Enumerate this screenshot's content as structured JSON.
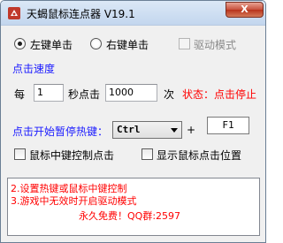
{
  "window": {
    "title": "天蝎鼠标连点器 V19.1",
    "close_glyph": "X"
  },
  "mouse_button": {
    "left_label": "左键单击",
    "right_label": "右键单击",
    "selected": "left"
  },
  "driver_mode": {
    "label": "驱动模式",
    "checked": false,
    "enabled": false
  },
  "speed": {
    "section_label": "点击速度",
    "prefix": "每",
    "seconds_value": "1",
    "middle": "秒点击",
    "clicks_value": "1000",
    "suffix": "次"
  },
  "status": {
    "text": "状态：点击停止",
    "color": "#ff0000"
  },
  "hotkey": {
    "label": "点击开始暂停热键：",
    "modifier": "Ctrl",
    "plus": "+",
    "key": "F1"
  },
  "options": {
    "middle_click_label": "鼠标中键控制点击",
    "middle_click_checked": false,
    "show_position_label": "显示鼠标点击位置",
    "show_position_checked": false
  },
  "info": {
    "lines": [
      "2.设置热键或鼠标中键控制",
      "3.游戏中无效时开启驱动模式",
      "永久免费！QQ群:2597"
    ],
    "color": "#ff0000"
  },
  "colors": {
    "accent_blue": "#1a1aff",
    "status_red": "#ff0000"
  }
}
